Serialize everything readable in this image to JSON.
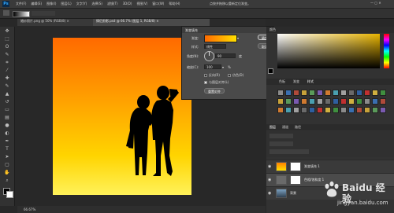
{
  "menubar": {
    "logo": "Ps",
    "items": [
      "文件(F)",
      "编辑(E)",
      "图像(I)",
      "图层(L)",
      "文字(Y)",
      "选择(S)",
      "滤镜(T)",
      "3D(D)",
      "视图(V)",
      "窗口(W)",
      "帮助(H)"
    ],
    "hint": "点按并拖移以重新定位渐变。"
  },
  "tabs": [
    {
      "label": "婚纱照片.png @ 50% (RGB/8) ×",
      "active": false
    },
    {
      "label": "情侣剪影.psd @ 66.7% (图层 1, RGB/8) ×",
      "active": true
    }
  ],
  "dialog": {
    "title": "渐变填充",
    "gradient_label": "渐变:",
    "style_label": "样式:",
    "style_value": "线性",
    "angle_label": "角度(N):",
    "angle_value": "90",
    "angle_unit": "度",
    "scale_label": "缩放(C):",
    "scale_value": "100",
    "scale_unit": "%",
    "reverse_label": "反向(R)",
    "dither_label": "仿色(D)",
    "align_label": "与图层对齐(L)",
    "reset_label": "重置对齐",
    "ok_label": "确定",
    "cancel_label": "取消",
    "reverse_checked": false,
    "dither_checked": false,
    "align_checked": true,
    "gradient_colors": [
      "#ff6a00",
      "#ffe000"
    ]
  },
  "panels": {
    "color_tab": "颜色",
    "swatches_tabs": [
      "色板",
      "渐变",
      "样式"
    ],
    "layers_tabs": [
      "图层",
      "通道",
      "路径"
    ],
    "layers": [
      {
        "name": "渐变填充 1",
        "selected": false
      },
      {
        "name": "色相/饱和度 1",
        "selected": true
      },
      {
        "name": "背景",
        "selected": false
      }
    ]
  },
  "status": {
    "zoom": "66.67%"
  },
  "watermark": {
    "title": "Baidu 经验",
    "url": "jingyan.baidu.com"
  },
  "colors": {
    "fg": "#000000",
    "bg": "#ffffff",
    "accent": "#31a8ff"
  }
}
